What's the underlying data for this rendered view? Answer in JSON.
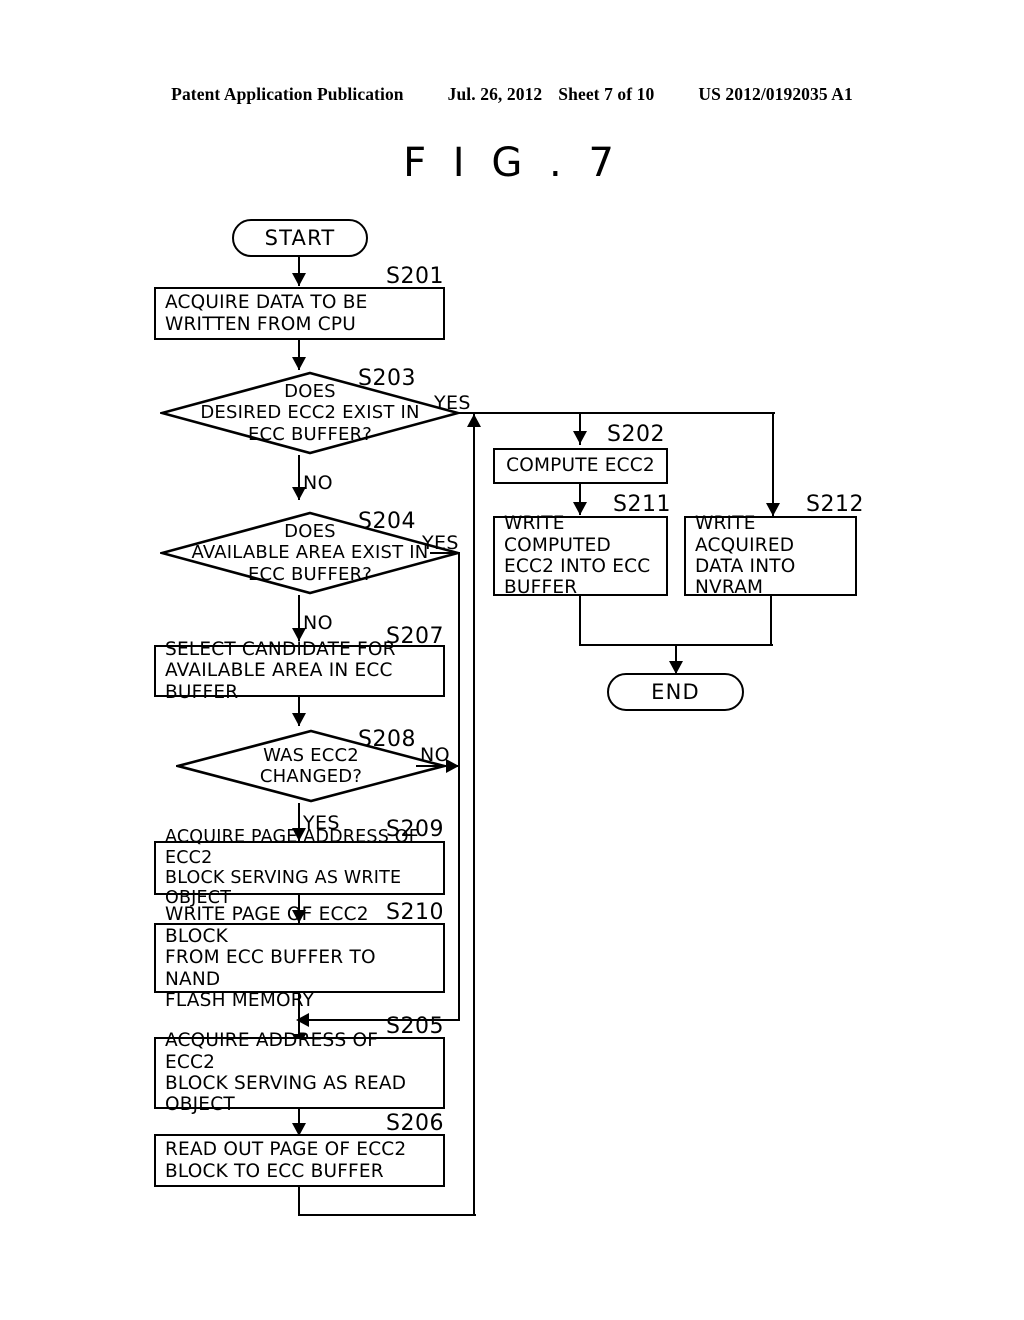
{
  "header": {
    "publication": "Patent Application Publication",
    "date": "Jul. 26, 2012",
    "sheet": "Sheet 7 of 10",
    "document_number": "US 2012/0192035 A1"
  },
  "figure": {
    "title": "F I G . 7"
  },
  "flowchart": {
    "terminals": {
      "start": "START",
      "end": "END"
    },
    "steps": [
      {
        "id": "S201",
        "label": "S201",
        "text": "ACQUIRE DATA TO BE\nWRITTEN FROM CPU",
        "shape": "process"
      },
      {
        "id": "S203",
        "label": "S203",
        "text": "DOES\nDESIRED ECC2 EXIST IN\nECC BUFFER?",
        "shape": "decision"
      },
      {
        "id": "S204",
        "label": "S204",
        "text": "DOES\nAVAILABLE AREA EXIST IN\nECC BUFFER?",
        "shape": "decision"
      },
      {
        "id": "S207",
        "label": "S207",
        "text": "SELECT CANDIDATE FOR\nAVAILABLE AREA IN ECC BUFFER",
        "shape": "process"
      },
      {
        "id": "S208",
        "label": "S208",
        "text": "WAS ECC2\nCHANGED?",
        "shape": "decision"
      },
      {
        "id": "S209",
        "label": "S209",
        "text": "ACQUIRE PAGE ADDRESS OF ECC2\nBLOCK SERVING AS WRITE OBJECT",
        "shape": "process"
      },
      {
        "id": "S210",
        "label": "S210",
        "text": "WRITE PAGE OF ECC2 BLOCK\nFROM ECC BUFFER TO NAND\nFLASH MEMORY",
        "shape": "process"
      },
      {
        "id": "S205",
        "label": "S205",
        "text": "ACQUIRE ADDRESS OF ECC2\nBLOCK SERVING AS READ\nOBJECT",
        "shape": "process"
      },
      {
        "id": "S206",
        "label": "S206",
        "text": "READ OUT PAGE OF ECC2\nBLOCK TO ECC BUFFER",
        "shape": "process"
      },
      {
        "id": "S202",
        "label": "S202",
        "text": "COMPUTE ECC2",
        "shape": "process"
      },
      {
        "id": "S211",
        "label": "S211",
        "text": "WRITE COMPUTED\nECC2 INTO ECC\nBUFFER",
        "shape": "process"
      },
      {
        "id": "S212",
        "label": "S212",
        "text": "WRITE ACQUIRED\nDATA INTO\nNVRAM",
        "shape": "process"
      }
    ],
    "branch_labels": {
      "s203_yes": "YES",
      "s203_no": "NO",
      "s204_yes": "YES",
      "s204_no": "NO",
      "s208_no": "NO",
      "s208_yes": "YES"
    }
  },
  "colors": {
    "ink": "#000000",
    "paper": "#ffffff"
  }
}
